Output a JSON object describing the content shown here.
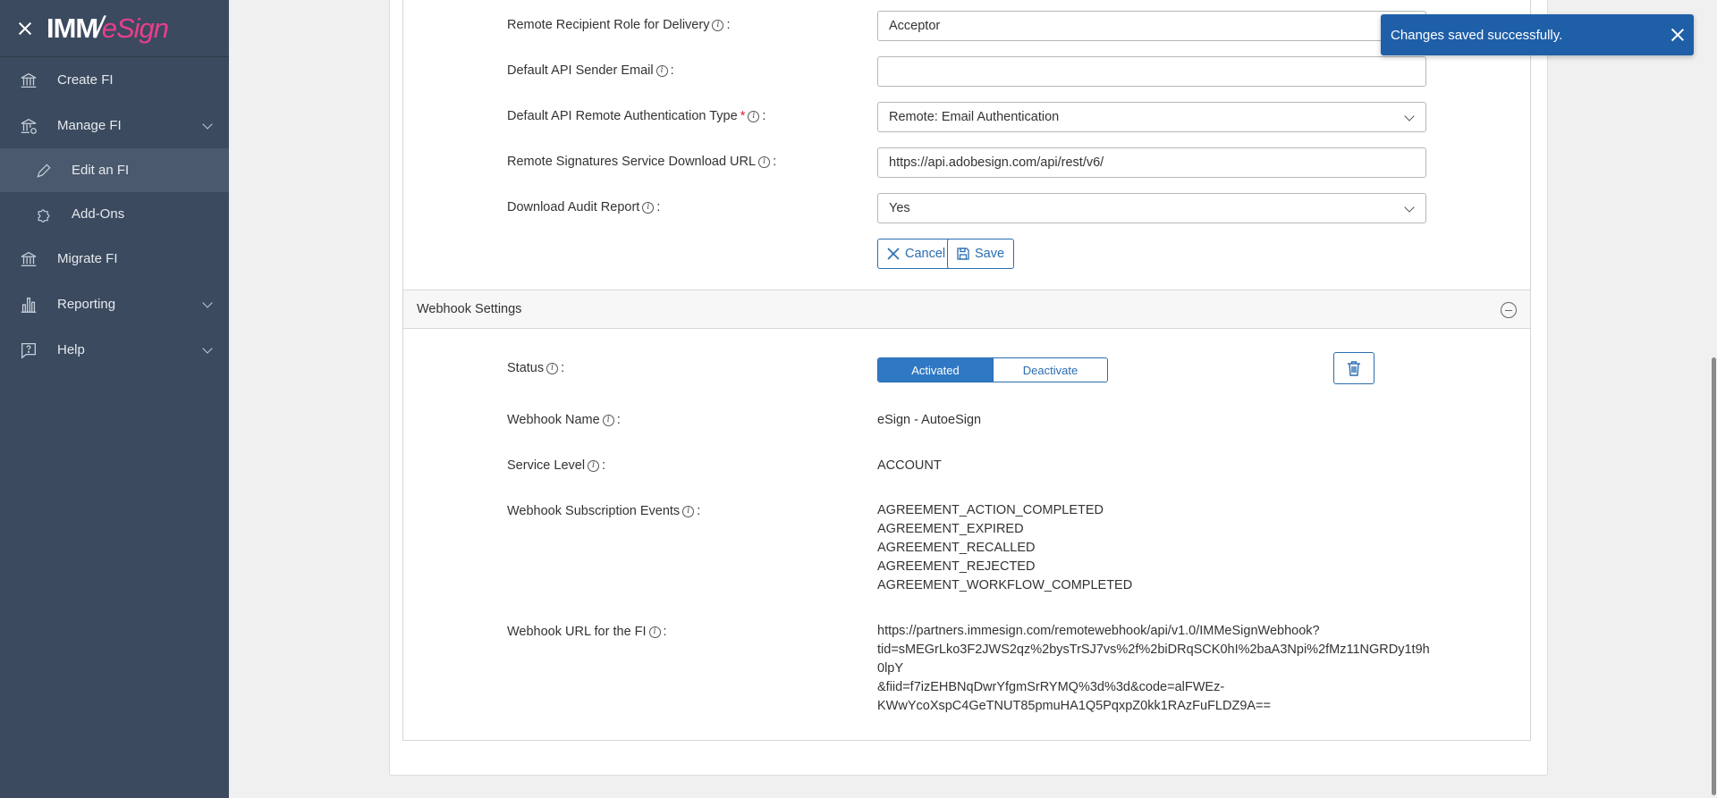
{
  "sidebar": {
    "logo": {
      "left": "IMM",
      "slash": "/",
      "right": "eSign"
    },
    "items": [
      {
        "label": "Create FI",
        "icon": "bank-icon"
      },
      {
        "label": "Manage FI",
        "icon": "bank-gear-icon"
      },
      {
        "label": "Edit an FI",
        "icon": "pencil-icon"
      },
      {
        "label": "Add-Ons",
        "icon": "puzzle-icon"
      },
      {
        "label": "Migrate FI",
        "icon": "bank-icon"
      },
      {
        "label": "Reporting",
        "icon": "bar-chart-icon"
      },
      {
        "label": "Help",
        "icon": "help-bubble-icon"
      }
    ]
  },
  "form": {
    "remote_role": {
      "label": "Remote Recipient Role for Delivery",
      "value": "Acceptor"
    },
    "sender_email": {
      "label": "Default API Sender Email",
      "value": ""
    },
    "auth_type": {
      "label": "Default API Remote Authentication Type",
      "required_mark": "*",
      "value": "Remote: Email Authentication"
    },
    "download_url": {
      "label": "Remote Signatures Service Download URL",
      "value": "https://api.adobesign.com/api/rest/v6/"
    },
    "audit_report": {
      "label": "Download Audit Report",
      "value": "Yes"
    },
    "colon": ":",
    "cancel_label": "Cancel",
    "save_label": "Save"
  },
  "webhook": {
    "section_title": "Webhook Settings",
    "status": {
      "label": "Status",
      "activated": "Activated",
      "deactivate": "Deactivate"
    },
    "name": {
      "label": "Webhook Name",
      "value": "eSign - AutoeSign"
    },
    "service_level": {
      "label": "Service Level",
      "value": "ACCOUNT"
    },
    "events": {
      "label": "Webhook Subscription Events",
      "values": [
        "AGREEMENT_ACTION_COMPLETED",
        "AGREEMENT_EXPIRED",
        "AGREEMENT_RECALLED",
        "AGREEMENT_REJECTED",
        "AGREEMENT_WORKFLOW_COMPLETED"
      ]
    },
    "url": {
      "label": "Webhook URL for the FI",
      "lines": [
        "https://partners.immesign.com/remotewebhook/api/v1.0/IMMeSignWebhook?",
        "tid=sMEGrLko3F2JWS2qz%2bysTrSJ7vs%2f%2biDRqSCK0hI%2baA3Npi%2fMz11NGRDy1t9h0lpY",
        "&fiid=f7izEHBNqDwrYfgmSrRYMQ%3d%3d&code=alFWEz-",
        "KWwYcoXspC4GeTNUT85pmuHA1Q5PqxpZ0kk1RAzFuFLDZ9A=="
      ]
    }
  },
  "toast": {
    "message": "Changes saved successfully."
  },
  "colors": {
    "sidebar": "#3b4a5e",
    "accent": "#2a6db0",
    "toast": "#1f5fa8",
    "brand_pink": "#e83e8c"
  }
}
